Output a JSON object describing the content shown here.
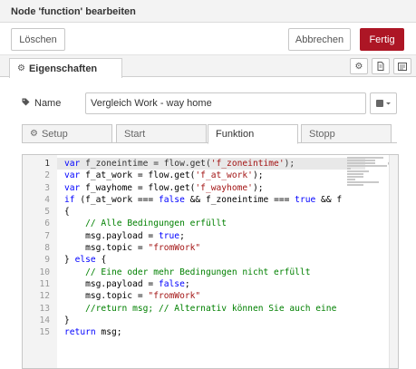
{
  "dialog": {
    "title": "Node 'function' bearbeiten"
  },
  "toolbar": {
    "delete_label": "Löschen",
    "cancel_label": "Abbrechen",
    "done_label": "Fertig"
  },
  "tray": {
    "properties_label": "Eigenschaften",
    "properties_icon": "gear-icon",
    "icons": [
      "gear-icon",
      "document-icon",
      "layout-icon"
    ]
  },
  "form": {
    "name_label": "Name",
    "name_icon": "tag-icon",
    "name_value": "Vergleich Work - way home",
    "icon_select": "book-icon"
  },
  "tabs": [
    {
      "label": "Setup",
      "icon": "gear-icon"
    },
    {
      "label": "Start"
    },
    {
      "label": "Funktion",
      "active": true
    },
    {
      "label": "Stopp"
    }
  ],
  "editor": {
    "current_line": 1,
    "lines": [
      {
        "n": "1",
        "code": "var f_zoneintime = flow.get('f_zoneintime');"
      },
      {
        "n": "2",
        "code": "var f_at_work = flow.get('f_at_work');"
      },
      {
        "n": "3",
        "code": "var f_wayhome = flow.get('f_wayhome');"
      },
      {
        "n": "4",
        "code": "if (f_at_work === false && f_zoneintime === true && f"
      },
      {
        "n": "5",
        "code": "{"
      },
      {
        "n": "6",
        "code": "    // Alle Bedingungen erfüllt"
      },
      {
        "n": "7",
        "code": "    msg.payload = true;"
      },
      {
        "n": "8",
        "code": "    msg.topic = \"fromWork\""
      },
      {
        "n": "9",
        "code": "} else {"
      },
      {
        "n": "10",
        "code": "    // Eine oder mehr Bedingungen nicht erfüllt"
      },
      {
        "n": "11",
        "code": "    msg.payload = false;"
      },
      {
        "n": "12",
        "code": "    msg.topic = \"fromWork\""
      },
      {
        "n": "13",
        "code": "    //return msg; // Alternativ können Sie auch eine"
      },
      {
        "n": "14",
        "code": "}"
      },
      {
        "n": "15",
        "code": "return msg;"
      }
    ],
    "colors": {
      "keyword": "#0000ff",
      "string": "#a31515",
      "comment": "#008000"
    }
  },
  "colors": {
    "primary": "#ad1625",
    "border": "#c7c7c7",
    "header_bg": "#f3f3f3"
  }
}
